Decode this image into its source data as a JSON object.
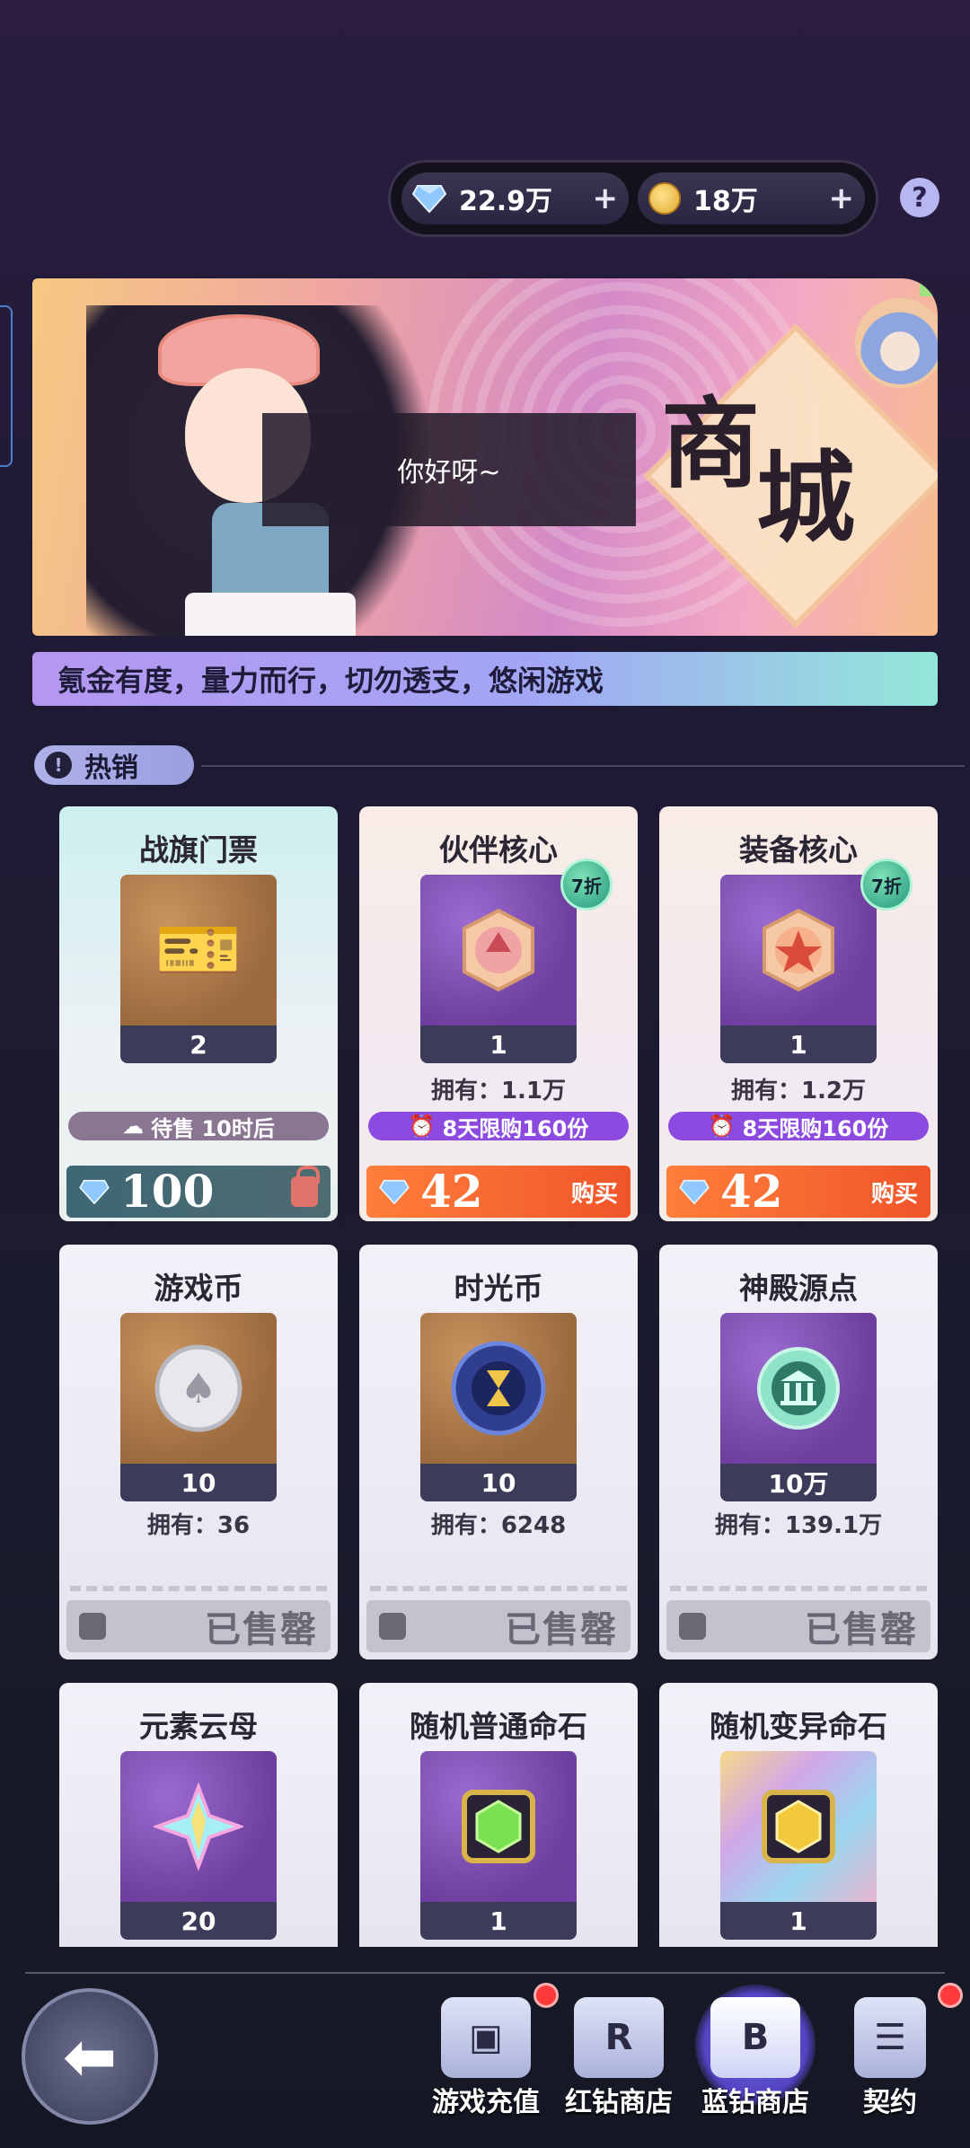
{
  "currency": {
    "blue_diamond": "22.9万",
    "gold": "18万",
    "plus_symbol": "+",
    "help_symbol": "?"
  },
  "banner": {
    "speech": "你好呀~",
    "title_1": "商",
    "title_2": "城"
  },
  "notice": "氪金有度，量力而行，切勿透支，悠闲游戏",
  "section": {
    "title": "热销",
    "icon_symbol": "!"
  },
  "cards": [
    {
      "name": "战旗门票",
      "qty": "2",
      "sale_time": "待售 10时后",
      "price": "100"
    },
    {
      "name": "伙伴核心",
      "qty": "1",
      "discount": "7折",
      "owned": "拥有：1.1万",
      "limit": "8天限购160份",
      "price": "42",
      "buy": "购买"
    },
    {
      "name": "装备核心",
      "qty": "1",
      "discount": "7折",
      "owned": "拥有：1.2万",
      "limit": "8天限购160份",
      "price": "42",
      "buy": "购买"
    },
    {
      "name": "游戏币",
      "qty": "10",
      "owned": "拥有：36",
      "sold": "已售罄"
    },
    {
      "name": "时光币",
      "qty": "10",
      "owned": "拥有：6248",
      "sold": "已售罄"
    },
    {
      "name": "神殿源点",
      "qty": "10万",
      "owned": "拥有：139.1万",
      "sold": "已售罄"
    },
    {
      "name": "元素云母",
      "qty": "20"
    },
    {
      "name": "随机普通命石",
      "qty": "1"
    },
    {
      "name": "随机变异命石",
      "qty": "1"
    }
  ],
  "nav": {
    "back_symbol": "⬅",
    "items": [
      {
        "label": "游戏充值",
        "icon": "wallet-icon",
        "glyph": "▣"
      },
      {
        "label": "红钻商店",
        "icon": "red-diamond-icon",
        "glyph": "R"
      },
      {
        "label": "蓝钻商店",
        "icon": "blue-diamond-icon",
        "glyph": "B"
      },
      {
        "label": "契约",
        "icon": "contract-icon",
        "glyph": "☰"
      }
    ]
  },
  "colors": {
    "accent_orange": "#f0552a",
    "limit_violet": "#8d4ae0",
    "active_nav": "#5244c2",
    "red_dot": "#ff3a3a"
  }
}
